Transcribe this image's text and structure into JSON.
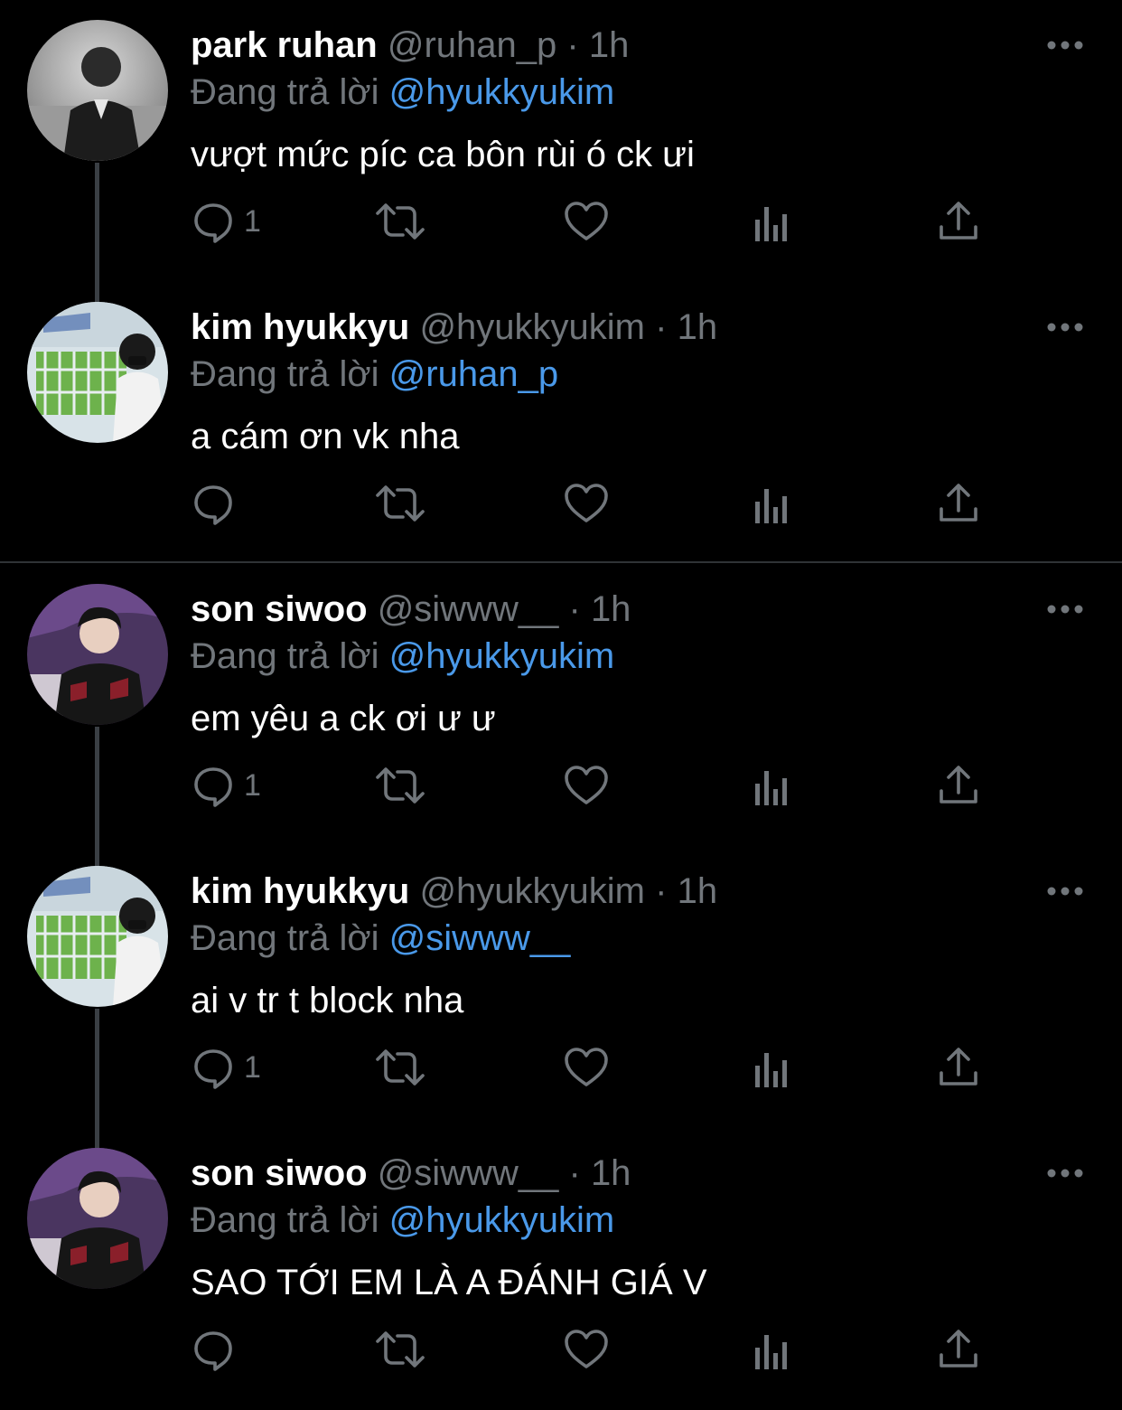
{
  "theme": {
    "background": "#000000",
    "text": "#ffffff",
    "muted": "#71767b",
    "accent": "#4a99e9",
    "thread_line": "#3a3f44"
  },
  "replying_label": "Đang trả lời",
  "tweets": [
    {
      "name": "park ruhan",
      "handle": "@ruhan_p",
      "dot": "·",
      "time": "1h",
      "reply_to": "@hyukkyukim",
      "text": "vượt mức píc ca bôn rùi ó ck ưi",
      "reply_count": "1",
      "avatar_icon": "avatar-photo-man-in-suit"
    },
    {
      "name": "kim hyukkyu",
      "handle": "@hyukkyukim",
      "dot": "·",
      "time": "1h",
      "reply_to": "@ruhan_p",
      "text": "a cám ơn vk nha",
      "reply_count": "",
      "avatar_icon": "avatar-photo-person-with-puppies"
    },
    {
      "name": "son siwoo",
      "handle": "@siwww__",
      "dot": "·",
      "time": "1h",
      "reply_to": "@hyukkyukim",
      "text": "em yêu a ck ơi ư ư",
      "reply_count": "1",
      "avatar_icon": "avatar-photo-player-in-jacket"
    },
    {
      "name": "kim hyukkyu",
      "handle": "@hyukkyukim",
      "dot": "·",
      "time": "1h",
      "reply_to": "@siwww__",
      "text": "ai v tr t block nha",
      "reply_count": "1",
      "avatar_icon": "avatar-photo-person-with-puppies"
    },
    {
      "name": "son siwoo",
      "handle": "@siwww__",
      "dot": "·",
      "time": "1h",
      "reply_to": "@hyukkyukim",
      "text": "SAO TỚI EM LÀ A ĐÁNH GIÁ V",
      "reply_count": "",
      "avatar_icon": "avatar-photo-player-in-jacket"
    }
  ]
}
